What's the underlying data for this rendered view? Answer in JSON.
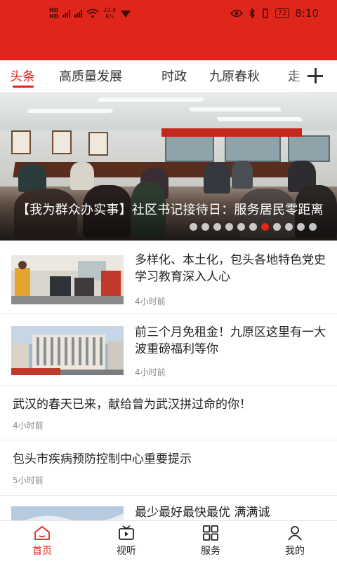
{
  "status_bar": {
    "signal_labels": [
      "HD",
      "HD"
    ],
    "network_small": [
      "4G",
      "4G"
    ],
    "speed_value": "22.8",
    "speed_unit": "K/s",
    "battery": "72",
    "time": "8:10"
  },
  "tabs": [
    {
      "label": "头条",
      "active": true
    },
    {
      "label": "高质量发展",
      "active": false
    },
    {
      "label": "时政",
      "active": false
    },
    {
      "label": "九原春秋",
      "active": false
    },
    {
      "label": "走",
      "active": false
    }
  ],
  "banner": {
    "title": "【我为群众办实事】社区书记接待日：服务居民零距离",
    "slide_count": 11,
    "active_slide": 7
  },
  "news": [
    {
      "title": "多样化、本土化，包头各地特色党史学习教育深入人心",
      "time": "4小时前",
      "has_thumb": true
    },
    {
      "title": "前三个月免租金！九原区这里有一大波重磅福利等你",
      "time": "4小时前",
      "has_thumb": true
    },
    {
      "title": "武汉的春天已来，献给曾为武汉拼过命的你！",
      "time": "4小时前",
      "has_thumb": false
    },
    {
      "title": "包头市疾病预防控制中心重要提示",
      "time": "5小时前",
      "has_thumb": false
    },
    {
      "title": "最少最好最快最优 满满诚",
      "time": "",
      "has_thumb": true
    }
  ],
  "bottom_nav": [
    {
      "label": "首页",
      "icon": "home-icon",
      "active": true
    },
    {
      "label": "视听",
      "icon": "video-icon",
      "active": false
    },
    {
      "label": "服务",
      "icon": "grid-icon",
      "active": false
    },
    {
      "label": "我的",
      "icon": "user-icon",
      "active": false
    }
  ],
  "colors": {
    "accent": "#e0251a",
    "status_bar": "#e0251a"
  }
}
